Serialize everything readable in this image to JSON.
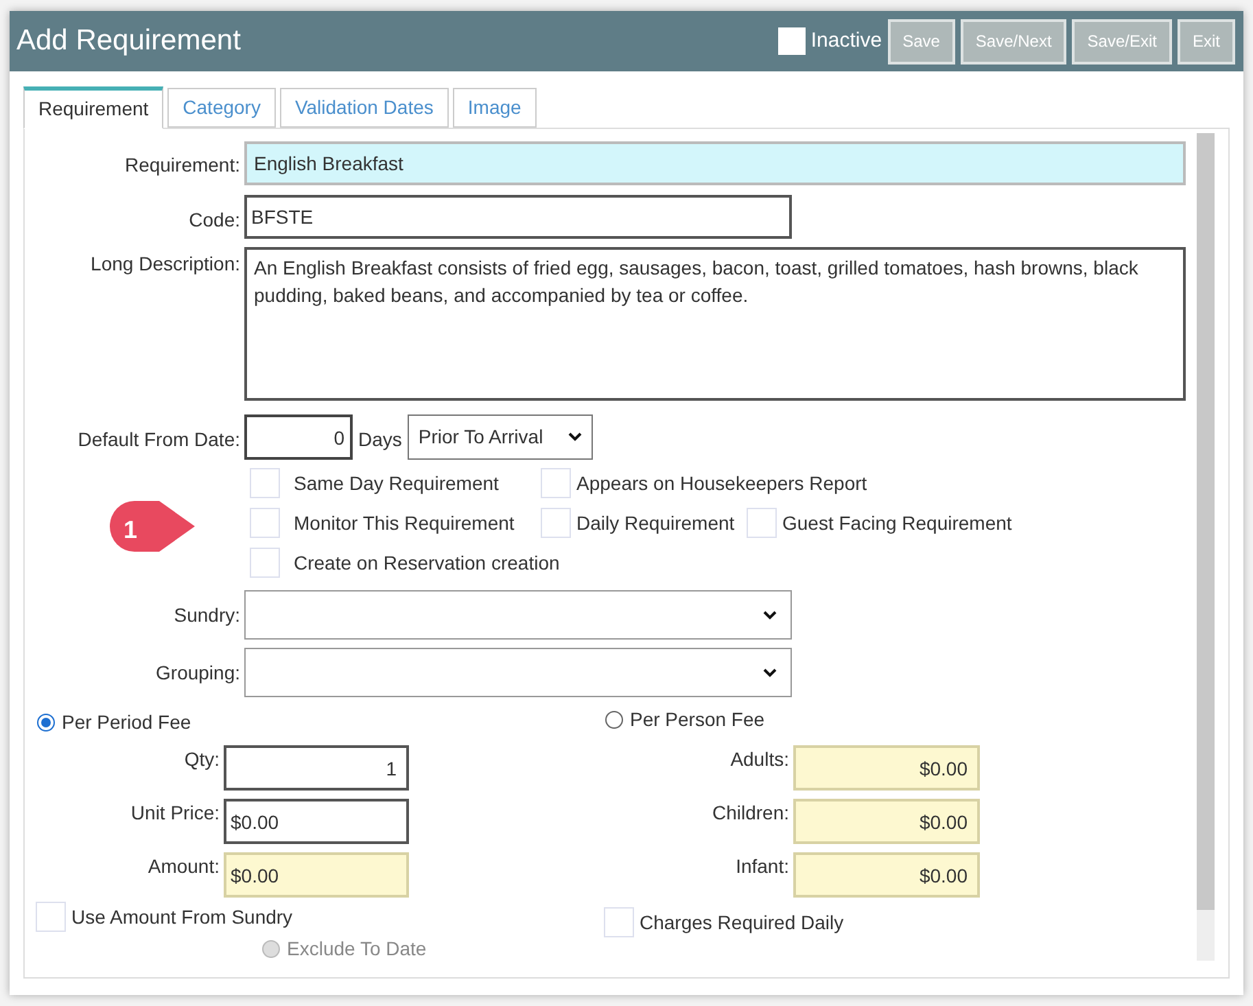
{
  "window": {
    "title": "Add Requirement",
    "inactive": {
      "label": "Inactive",
      "checked": false
    },
    "buttons": [
      "Save",
      "Save/Next",
      "Save/Exit",
      "Exit"
    ]
  },
  "tabs": [
    {
      "label": "Requirement",
      "selected": true
    },
    {
      "label": "Category",
      "selected": false
    },
    {
      "label": "Validation Dates",
      "selected": false
    },
    {
      "label": "Image",
      "selected": false
    }
  ],
  "requirement": {
    "label": "Requirement:",
    "value": "English Breakfast"
  },
  "code": {
    "label": "Code:",
    "value": "BFSTE"
  },
  "long_description": {
    "label": "Long Description:",
    "value": "An English Breakfast consists of fried egg, sausages, bacon, toast, grilled tomatoes, hash browns, black pudding, baked beans, and accompanied by tea or coffee."
  },
  "default_from_date": {
    "label": "Default From Date:",
    "value": "0",
    "unit": "Days",
    "timing": "Prior To Arrival"
  },
  "options": [
    {
      "label": "Same Day Requirement",
      "checked": false
    },
    {
      "label": "Appears on Housekeepers Report",
      "checked": false
    },
    {
      "label": "Monitor This Requirement",
      "checked": false
    },
    {
      "label": "Daily Requirement",
      "checked": false
    },
    {
      "label": "Guest Facing Requirement",
      "checked": false
    },
    {
      "label": "Create on Reservation creation",
      "checked": false
    }
  ],
  "callout": "1",
  "sundry": {
    "label": "Sundry:"
  },
  "grouping": {
    "label": "Grouping:"
  },
  "fee_modes": [
    {
      "label": "Per Period Fee",
      "selected": true
    },
    {
      "label": "Per Person Fee",
      "selected": false
    }
  ],
  "period_fields": [
    {
      "label": "Qty:",
      "value": "1",
      "kind": "edit"
    },
    {
      "label": "Unit Price:",
      "value": "$0.00",
      "kind": "edit"
    },
    {
      "label": "Amount:",
      "value": "$0.00",
      "kind": "computed"
    }
  ],
  "person_fields": [
    {
      "label": "Adults:",
      "value": "$0.00"
    },
    {
      "label": "Children:",
      "value": "$0.00"
    },
    {
      "label": "Infant:",
      "value": "$0.00"
    }
  ],
  "use_amount_from_sundry": {
    "label": "Use Amount From Sundry",
    "checked": false
  },
  "charges_required_daily": {
    "label": "Charges Required Daily",
    "checked": false
  },
  "exclude_to_date": {
    "label": "Exclude To Date",
    "selected": false,
    "disabled": true
  }
}
